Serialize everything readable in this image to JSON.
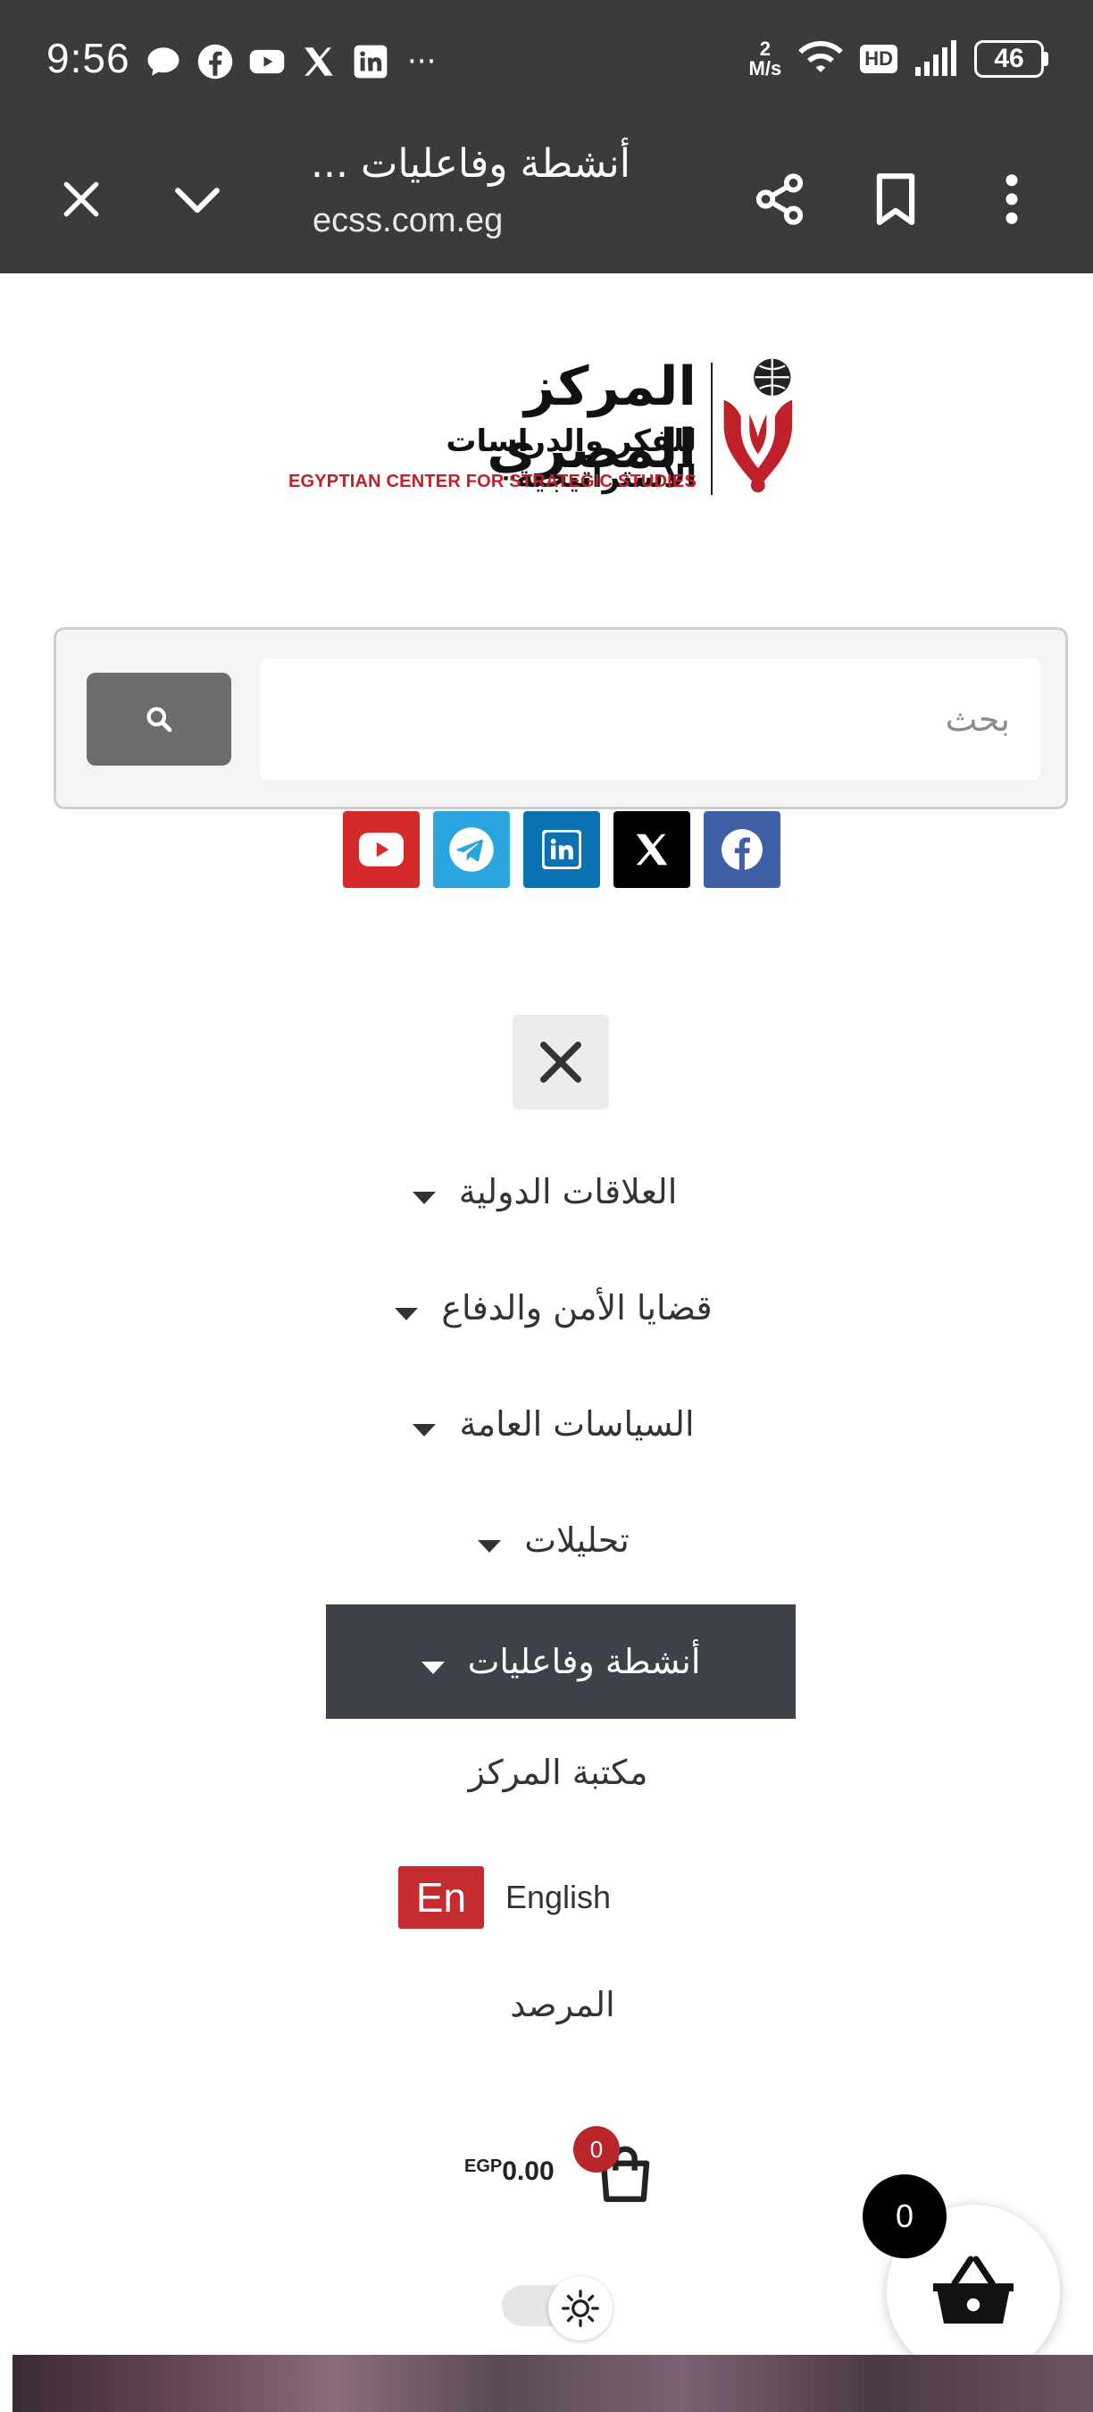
{
  "status_bar": {
    "time": "9:56",
    "app_icons": [
      "chat-bubble-icon",
      "facebook-icon",
      "youtube-icon",
      "x-icon",
      "linkedin-icon"
    ],
    "more": "···",
    "net_speed_value": "2",
    "net_speed_unit": "M/s",
    "hd": "HD",
    "battery": "46"
  },
  "browser": {
    "title": "أنشطة وفاعليات ...",
    "url": "ecss.com.eg"
  },
  "logo": {
    "arabic_line1": "المركز المصري",
    "arabic_line2": "للفكر والدراسات الاستراتيجية",
    "english": "EGYPTIAN CENTER FOR STRATEGIC STUDIES"
  },
  "search": {
    "placeholder": "بحث",
    "value": ""
  },
  "socials": [
    "youtube",
    "telegram",
    "linkedin",
    "x",
    "facebook"
  ],
  "colors": {
    "chrome": "#3a3b3d",
    "brand_red": "#c0202a",
    "active_menu": "#3e4248",
    "youtube": "#d42a2a",
    "telegram": "#2ba5e0",
    "linkedin": "#0a72b0",
    "x": "#000000",
    "facebook": "#3f5fa6"
  },
  "menu": {
    "items": [
      {
        "label": "العلاقات الدولية",
        "has_submenu": true
      },
      {
        "label": "قضايا الأمن والدفاع",
        "has_submenu": true
      },
      {
        "label": "السياسات العامة",
        "has_submenu": true
      },
      {
        "label": "تحليلات",
        "has_submenu": true
      },
      {
        "label": "أنشطة وفاعليات",
        "has_submenu": true,
        "active": true
      },
      {
        "label": "مكتبة المركز",
        "has_submenu": false
      }
    ],
    "language": {
      "flag": "En",
      "label": "English"
    },
    "observatory": "المرصد"
  },
  "cart": {
    "currency": "EGP",
    "amount": "0.00",
    "count": "0"
  },
  "floating_cart": {
    "count": "0"
  }
}
